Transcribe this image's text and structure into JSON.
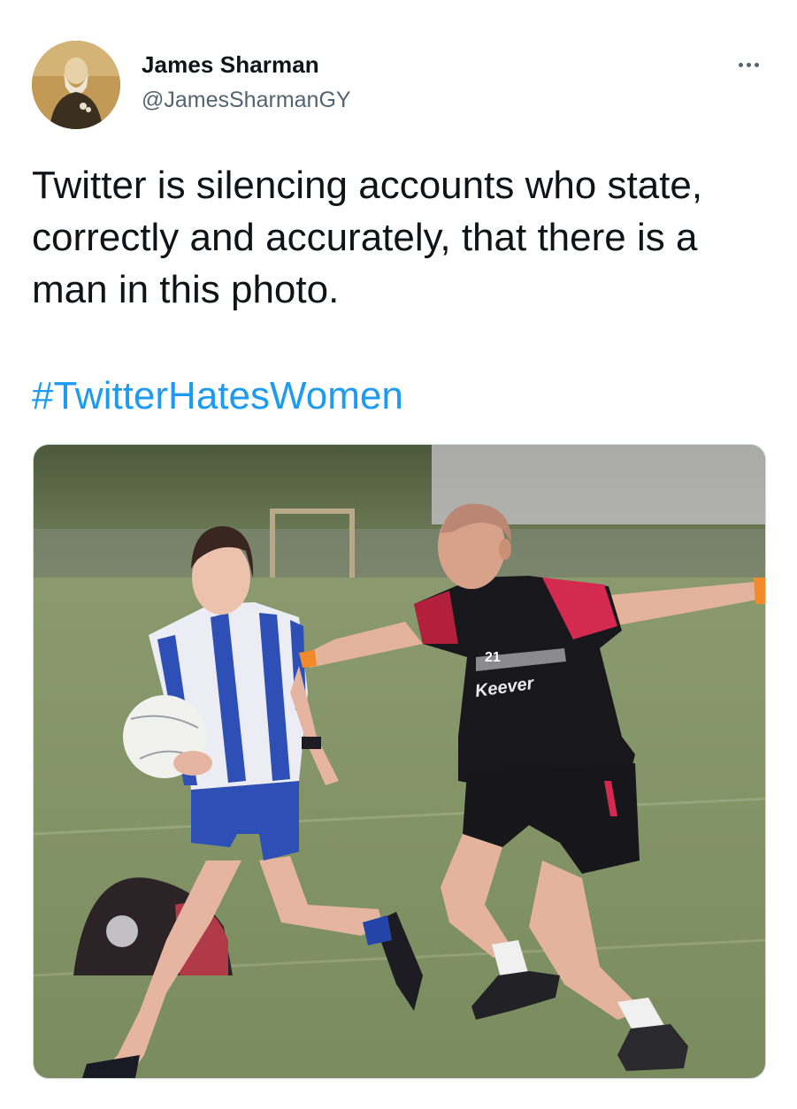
{
  "tweet": {
    "author": {
      "name": "James Sharman",
      "handle": "@JamesSharmanGY"
    },
    "text": "Twitter is silencing accounts who state, correctly and accurately, that there is a man in this photo.",
    "hashtag": "#TwitterHatesWomen",
    "more_icon": "more-horizontal-icon",
    "media": {
      "type": "photo",
      "jersey_number": "21",
      "jersey_sponsor": "Keever"
    }
  },
  "colors": {
    "text": "#0f1419",
    "secondary": "#536471",
    "link": "#1d9bf0",
    "border": "#cfd9de"
  }
}
